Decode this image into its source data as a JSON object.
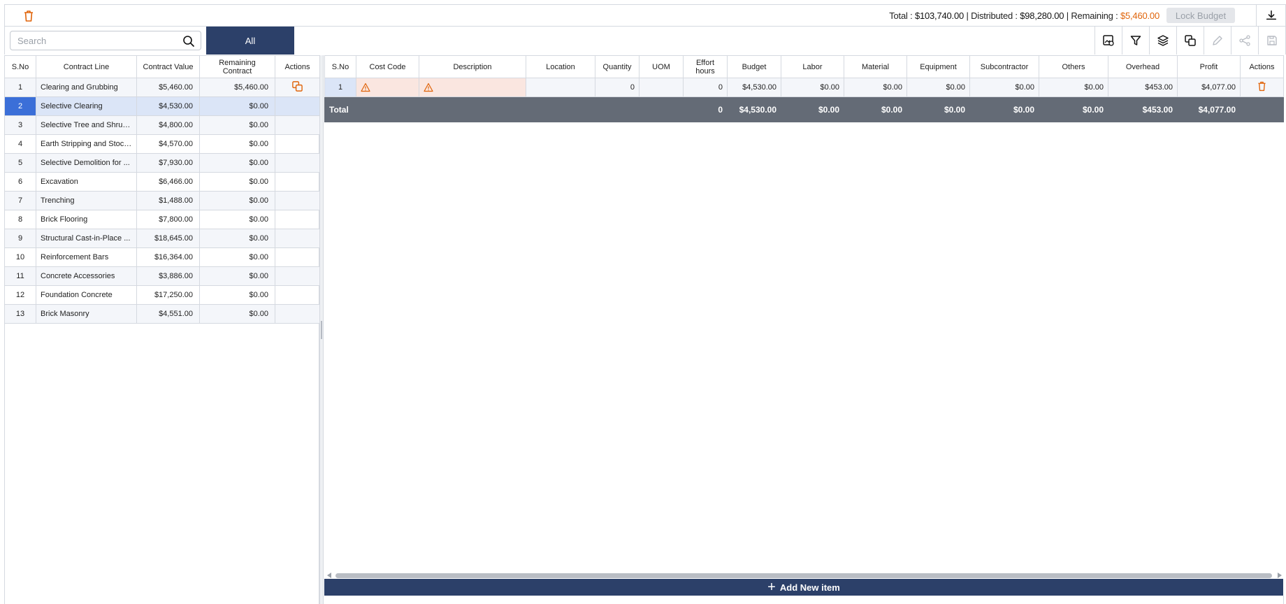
{
  "summary": {
    "total_label": "Total :",
    "total_value": "$103,740.00",
    "distributed_label": "Distributed :",
    "distributed_value": "$98,280.00",
    "remaining_label": "Remaining :",
    "remaining_value": "$5,460.00",
    "separator": "|",
    "lock_budget": "Lock Budget"
  },
  "search": {
    "placeholder": "Search"
  },
  "tabs": {
    "all": "All"
  },
  "colors": {
    "accent": "#2c4069",
    "warning": "#e0640a",
    "selected": "#3b6fd8",
    "total_row": "#646b76"
  },
  "left_table": {
    "headers": [
      "S.No",
      "Contract Line",
      "Contract Value",
      "Remaining Contract",
      "Actions"
    ],
    "rows": [
      {
        "sno": "1",
        "line": "Clearing and Grubbing",
        "value": "$5,460.00",
        "remaining": "$5,460.00"
      },
      {
        "sno": "2",
        "line": "Selective Clearing",
        "value": "$4,530.00",
        "remaining": "$0.00"
      },
      {
        "sno": "3",
        "line": "Selective Tree and Shrub ...",
        "value": "$4,800.00",
        "remaining": "$0.00"
      },
      {
        "sno": "4",
        "line": "Earth Stripping and Stock...",
        "value": "$4,570.00",
        "remaining": "$0.00"
      },
      {
        "sno": "5",
        "line": "Selective Demolition for ...",
        "value": "$7,930.00",
        "remaining": "$0.00"
      },
      {
        "sno": "6",
        "line": "Excavation",
        "value": "$6,466.00",
        "remaining": "$0.00"
      },
      {
        "sno": "7",
        "line": "Trenching",
        "value": "$1,488.00",
        "remaining": "$0.00"
      },
      {
        "sno": "8",
        "line": "Brick Flooring",
        "value": "$7,800.00",
        "remaining": "$0.00"
      },
      {
        "sno": "9",
        "line": "Structural Cast-in-Place ...",
        "value": "$18,645.00",
        "remaining": "$0.00"
      },
      {
        "sno": "10",
        "line": "Reinforcement Bars",
        "value": "$16,364.00",
        "remaining": "$0.00"
      },
      {
        "sno": "11",
        "line": "Concrete Accessories",
        "value": "$3,886.00",
        "remaining": "$0.00"
      },
      {
        "sno": "12",
        "line": "Foundation Concrete",
        "value": "$17,250.00",
        "remaining": "$0.00"
      },
      {
        "sno": "13",
        "line": "Brick Masonry",
        "value": "$4,551.00",
        "remaining": "$0.00"
      }
    ]
  },
  "right_table": {
    "headers": [
      "S.No",
      "Cost Code",
      "Description",
      "Location",
      "Quantity",
      "UOM",
      "Effort hours",
      "Budget",
      "Labor",
      "Material",
      "Equipment",
      "Subcontractor",
      "Others",
      "Overhead",
      "Profit",
      "Actions"
    ],
    "row": {
      "sno": "1",
      "cost_code": "",
      "description": "",
      "location": "",
      "quantity": "0",
      "uom": "",
      "effort": "0",
      "budget": "$4,530.00",
      "labor": "$0.00",
      "material": "$0.00",
      "equipment": "$0.00",
      "subcontractor": "$0.00",
      "others": "$0.00",
      "overhead": "$453.00",
      "profit": "$4,077.00"
    },
    "total": {
      "label": "Total",
      "effort": "0",
      "budget": "$4,530.00",
      "labor": "$0.00",
      "material": "$0.00",
      "equipment": "$0.00",
      "subcontractor": "$0.00",
      "others": "$0.00",
      "overhead": "$453.00",
      "profit": "$4,077.00"
    }
  },
  "add_item": "Add New item",
  "icons": {
    "top_delete": "trash-icon",
    "download": "download-icon",
    "search": "search-icon",
    "toolbar": [
      "image-settings-icon",
      "filter-icon",
      "layers-icon",
      "copy-icon",
      "edit-icon",
      "share-icon",
      "save-icon"
    ],
    "row_action": "copy-icon",
    "row_delete": "trash-icon",
    "warning": "warning-icon"
  }
}
